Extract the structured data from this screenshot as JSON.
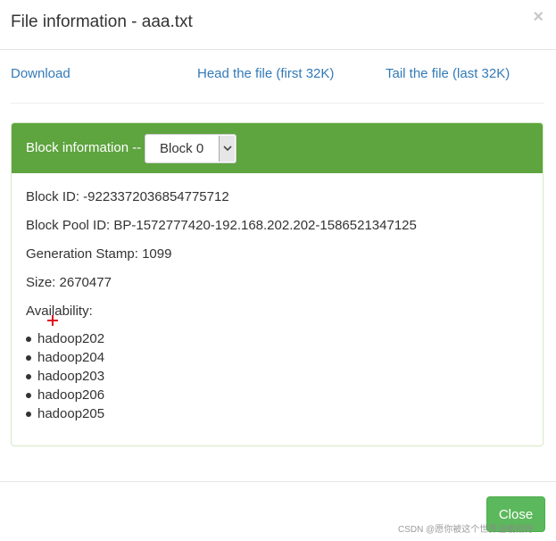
{
  "header": {
    "title": "File information - aaa.txt",
    "close_symbol": "×"
  },
  "links": {
    "download": "Download",
    "head": "Head the file (first 32K)",
    "tail": "Tail the file (last 32K)"
  },
  "panel": {
    "heading_label": "Block information --",
    "block_select": {
      "selected": "Block 0"
    },
    "block_id": "Block ID: -9223372036854775712",
    "block_pool_id": "Block Pool ID: BP-1572777420-192.168.202.202-1586521347125",
    "generation_stamp": "Generation Stamp: 1099",
    "size": "Size: 2670477",
    "availability_label": "Availability:",
    "availability": [
      "hadoop202",
      "hadoop204",
      "hadoop203",
      "hadoop206",
      "hadoop205"
    ]
  },
  "footer": {
    "close_label": "Close"
  },
  "watermark": "CSDN @愿你被这个世界温暖相待",
  "colors": {
    "panel_heading": "#5ea43f",
    "link": "#337ab7",
    "close_button": "#5cb85c",
    "cursor": "#e0131f"
  },
  "icons": [
    "close-icon",
    "chevron-down-icon",
    "crosshair-cursor-icon"
  ]
}
